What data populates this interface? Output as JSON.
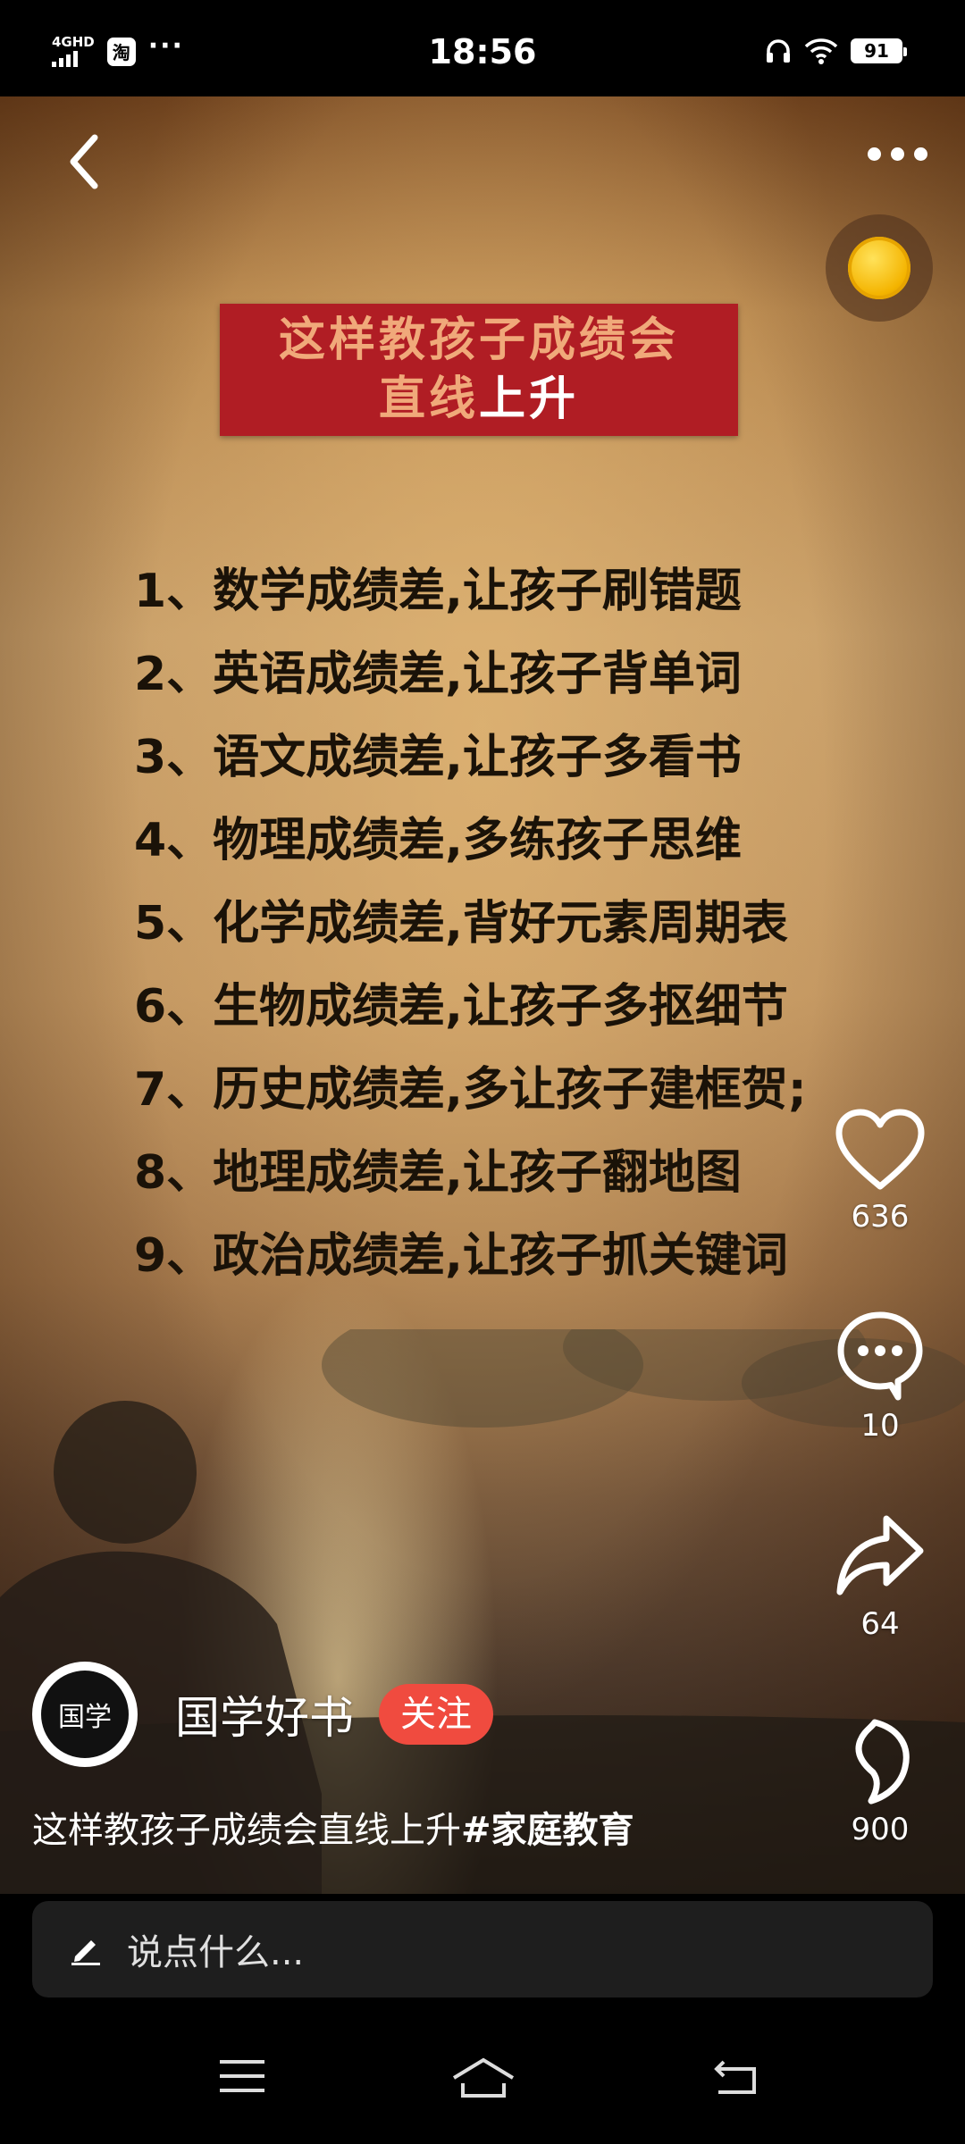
{
  "status_bar": {
    "network": "4GHD",
    "app_badge": "淘",
    "dots": "···",
    "time": "18:56",
    "battery": "91"
  },
  "video": {
    "title_line1": "这样教孩子成绩会",
    "title_line2_a": "直线",
    "title_line2_b": "上升",
    "items": [
      "1、数学成绩差,让孩子刷错题",
      "2、英语成绩差,让孩子背单词",
      "3、语文成绩差,让孩子多看书",
      "4、物理成绩差,多练孩子思维",
      "5、化学成绩差,背好元素周期表",
      "6、生物成绩差,让孩子多抠细节",
      "7、历史成绩差,多让孩子建框贺;",
      "8、地理成绩差,让孩子翻地图",
      "9、政治成绩差,让孩子抓关键词"
    ]
  },
  "actions": {
    "likes": "636",
    "comments": "10",
    "shares": "64",
    "favorites": "900"
  },
  "author": {
    "avatar_text": "国学",
    "name": "国学好书",
    "follow_label": "关注"
  },
  "caption": {
    "text": "这样教孩子成绩会直线上升",
    "hashtag": "#家庭教育"
  },
  "comment": {
    "placeholder": "说点什么..."
  },
  "icons": [
    "back-icon",
    "more-icon",
    "coin-icon",
    "heart-icon",
    "comment-icon",
    "share-icon",
    "favorite-icon",
    "pen-icon",
    "menu-icon",
    "home-icon",
    "return-icon"
  ]
}
